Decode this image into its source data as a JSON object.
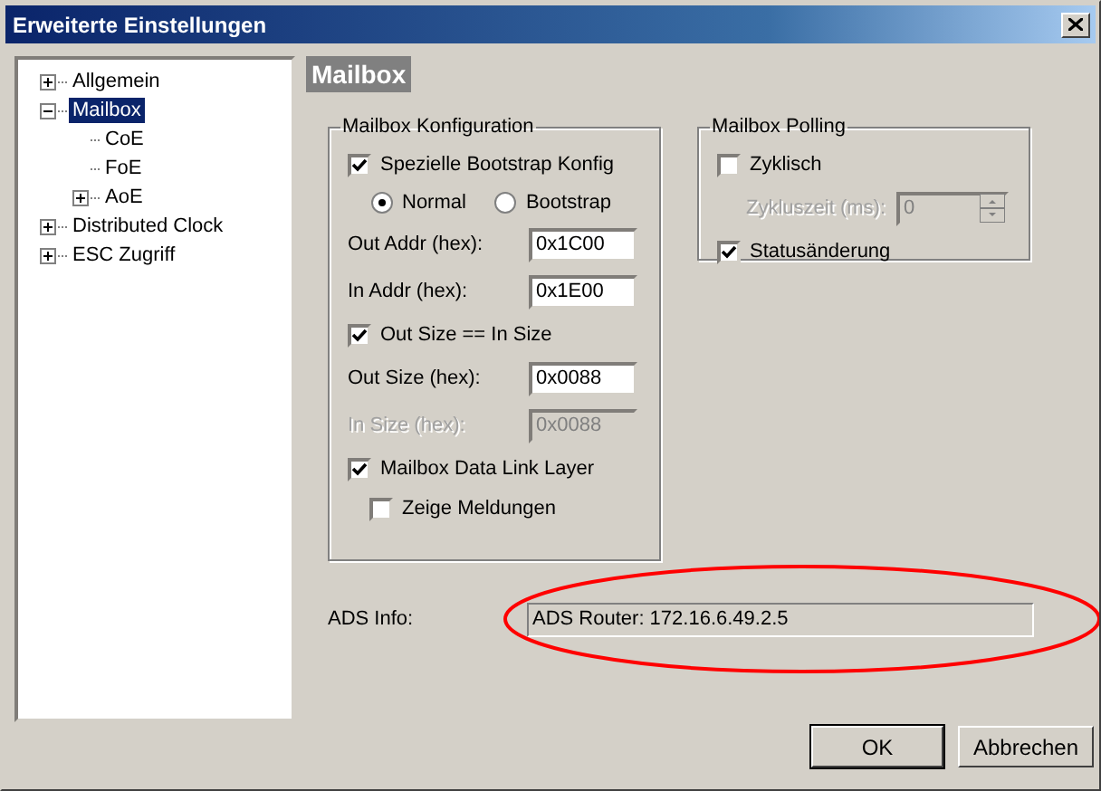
{
  "window": {
    "title": "Erweiterte Einstellungen"
  },
  "tree": [
    {
      "label": "Allgemein",
      "selected": false,
      "expanded": false
    },
    {
      "label": "Mailbox",
      "selected": true,
      "expanded": true,
      "children": [
        {
          "label": "CoE",
          "selected": false
        },
        {
          "label": "FoE",
          "selected": false
        },
        {
          "label": "AoE",
          "selected": false,
          "expanded": false
        }
      ]
    },
    {
      "label": "Distributed Clock",
      "selected": false,
      "expanded": false
    },
    {
      "label": "ESC Zugriff",
      "selected": false,
      "expanded": false
    }
  ],
  "page_title": "Mailbox",
  "mailbox_config": {
    "title": "Mailbox Konfiguration",
    "items": [
      {
        "kind": "checkbox",
        "label": "Spezielle Bootstrap Konfig",
        "checked": true
      },
      {
        "kind": "radio",
        "options": [
          {
            "label": "Normal",
            "selected": true
          },
          {
            "label": "Bootstrap",
            "selected": false
          }
        ]
      },
      {
        "kind": "field",
        "label": "Out Addr (hex):",
        "value": "0x1C00",
        "disabled": false
      },
      {
        "kind": "field",
        "label": "In Addr (hex):",
        "value": "0x1E00",
        "disabled": false
      },
      {
        "kind": "checkbox",
        "label": "Out Size == In Size",
        "checked": true
      },
      {
        "kind": "field",
        "label": "Out Size (hex):",
        "value": "0x0088",
        "disabled": false
      },
      {
        "kind": "field",
        "label": "In Size (hex):",
        "value": "0x0088",
        "disabled": true
      },
      {
        "kind": "checkbox",
        "label": "Mailbox Data Link Layer",
        "checked": true
      },
      {
        "kind": "sub_checkbox",
        "label": "Zeige Meldungen",
        "checked": false
      }
    ]
  },
  "polling": {
    "title": "Mailbox Polling",
    "items": [
      {
        "kind": "checkbox",
        "label": "Zyklisch",
        "checked": false
      },
      {
        "kind": "spinner",
        "label": "Zykluszeit (ms):",
        "value": "0",
        "disabled": true
      },
      {
        "kind": "checkbox",
        "label": "Statusänderung",
        "checked": true
      }
    ]
  },
  "ads_info": {
    "label": "ADS Info:",
    "value": "ADS Router: 172.16.6.49.2.5",
    "highlighted": true
  },
  "buttons": [
    {
      "label": "OK",
      "default": true
    },
    {
      "label": "Abbrechen",
      "default": false
    }
  ]
}
